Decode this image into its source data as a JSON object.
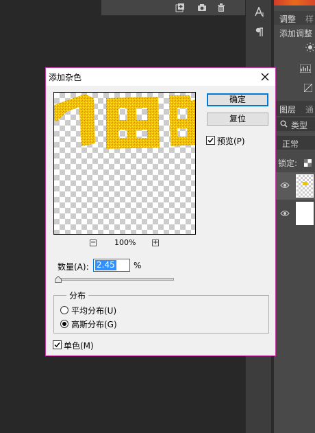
{
  "dialog": {
    "title": "添加杂色",
    "ok_label": "确定",
    "reset_label": "复位",
    "preview_label": "预览(P)",
    "preview_checked": true,
    "zoom_out_glyph": "−",
    "zoom_in_glyph": "+",
    "zoom_level": "100%",
    "amount_label": "数量(A):",
    "amount_value": "2.45",
    "amount_unit": "%",
    "distribution": {
      "legend": "分布",
      "uniform_label": "平均分布(U)",
      "gaussian_label": "高斯分布(G)",
      "selected": "gaussian"
    },
    "monochromatic_label": "单色(M)",
    "monochromatic_checked": true
  },
  "right_panel": {
    "tabs_top": [
      "调整",
      "样"
    ],
    "adjust_hint": "添加调整",
    "tabs_layers": [
      "图层",
      "通"
    ],
    "filter_label": "类型",
    "blend_mode": "正常",
    "lock_label": "锁定:"
  },
  "icons": [
    "new-layer-icon",
    "camera-icon",
    "trash-icon",
    "close-icon",
    "character-panel-icon",
    "paragraph-panel-icon",
    "search-icon",
    "eye-icon",
    "lock-transparent-icon"
  ],
  "colors": {
    "dialog_border": "#c838a8",
    "ok_focus": "#0078d7",
    "preview_text": "#f5c200",
    "selection": "#3390ff"
  }
}
